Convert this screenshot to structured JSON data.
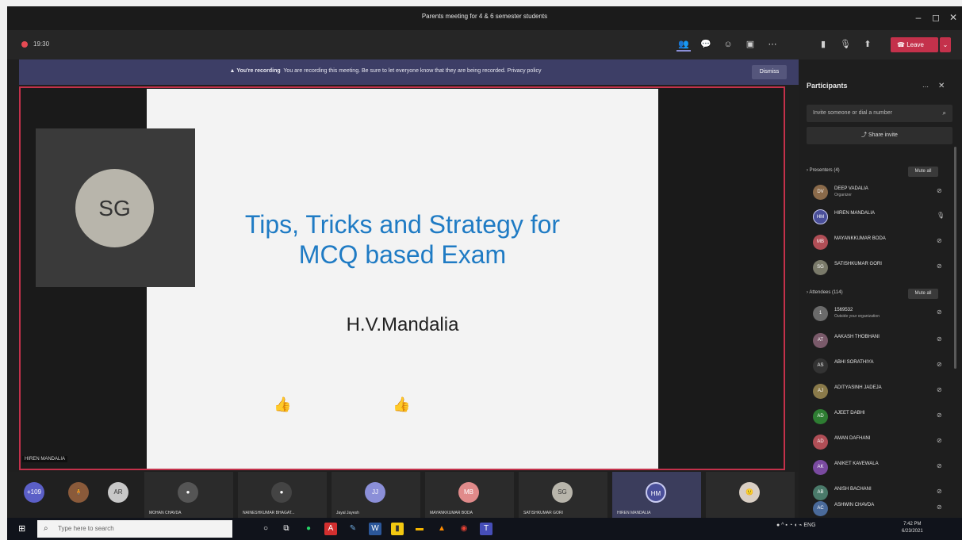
{
  "window": {
    "title": "Parents meeting for 4 & 6 semester students"
  },
  "toolbar": {
    "timer": "19:30",
    "leave_label": "Leave"
  },
  "banner": {
    "bold": "You're recording",
    "text": "You are recording this meeting. Be sure to let everyone know that they are being recorded. Privacy policy",
    "dismiss_label": "Dismiss"
  },
  "stage": {
    "slide_title_line1": "Tips, Tricks and Strategy for",
    "slide_title_line2": "MCQ based Exam",
    "slide_author": "H.V.Mandalia",
    "presenter_initials": "SG",
    "presenter_name": "HIREN MANDALIA"
  },
  "strip": {
    "overflow": "+109",
    "tiles": [
      {
        "initials": "AR",
        "name": ""
      },
      {
        "initials": "",
        "name": "MOHAN CHAVDA"
      },
      {
        "initials": "",
        "name": "NAINESHKUMAR BHAGAT..."
      },
      {
        "initials": "JJ",
        "name": "Jayal Jayesh"
      },
      {
        "initials": "MB",
        "name": "MAYANKKUMAR BODA"
      },
      {
        "initials": "SG",
        "name": "SATISHKUMAR GORI"
      },
      {
        "initials": "HM",
        "name": "HIREN MANDALIA"
      }
    ]
  },
  "panel": {
    "title": "Participants",
    "invite_placeholder": "Invite someone or dial a number",
    "share_invite": "Share invite",
    "presenters_head": "Presenters (4)",
    "attendees_head": "Attendees (114)",
    "mute_all": "Mute all",
    "presenters": [
      {
        "initials": "DV",
        "name": "DEEP VADALIA",
        "sub": "Organizer",
        "color": "#8a6a4a"
      },
      {
        "initials": "HM",
        "name": "HIREN MANDALIA",
        "sub": "",
        "color": "#4a4f9a"
      },
      {
        "initials": "MB",
        "name": "MAYANKKUMAR BODA",
        "sub": "",
        "color": "#b04e56"
      },
      {
        "initials": "SG",
        "name": "SATISHKUMAR GORI",
        "sub": "",
        "color": "#7a7a6a"
      }
    ],
    "attendees": [
      {
        "initials": "1",
        "name": "1569532",
        "sub": "Outside your organization",
        "color": "#6b6b6b"
      },
      {
        "initials": "AT",
        "name": "AAKASH THOBHANI",
        "sub": "",
        "color": "#7a5a6a"
      },
      {
        "initials": "AS",
        "name": "ABHI SORATHIYA",
        "sub": "",
        "color": "#333333"
      },
      {
        "initials": "AJ",
        "name": "ADITYASINH JADEJA",
        "sub": "",
        "color": "#8a7a4a"
      },
      {
        "initials": "AD",
        "name": "AJEET DABHI",
        "sub": "",
        "color": "#2e7d32"
      },
      {
        "initials": "AD",
        "name": "AMAN DAFHANI",
        "sub": "",
        "color": "#b04e56"
      },
      {
        "initials": "AK",
        "name": "ANIKET KAVEWALA",
        "sub": "",
        "color": "#7a4aa0"
      },
      {
        "initials": "AB",
        "name": "ANISH BACHANI",
        "sub": "",
        "color": "#4a7a6a"
      },
      {
        "initials": "AC",
        "name": "ASHWIN CHAVDA",
        "sub": "",
        "color": "#4a6a9a"
      }
    ]
  },
  "taskbar": {
    "search_placeholder": "Type here to search",
    "tray": "ENG",
    "time": "7:42 PM",
    "date": "6/23/2021"
  }
}
